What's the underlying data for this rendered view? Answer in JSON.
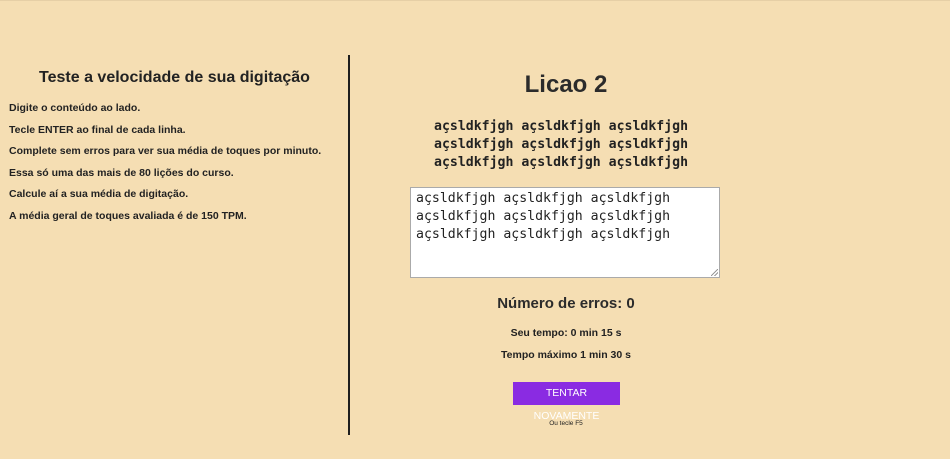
{
  "left_panel": {
    "title": "Teste a velocidade de sua digitação",
    "instructions": [
      "Digite o conteúdo ao lado.",
      "Tecle ENTER ao final de cada linha.",
      "Complete sem erros para ver sua média de toques por minuto.",
      "Essa só uma das mais de 80 lições do curso.",
      "Calcule aí a sua média de digitação.",
      "A média geral de toques avaliada é de 150 TPM."
    ]
  },
  "lesson": {
    "title": "Licao 2",
    "sample_lines": [
      "açsldkfjgh açsldkfjgh açsldkfjgh",
      "açsldkfjgh açsldkfjgh açsldkfjgh",
      "açsldkfjgh açsldkfjgh açsldkfjgh"
    ],
    "typed_text": "açsldkfjgh açsldkfjgh açsldkfjgh\naçsldkfjgh açsldkfjgh açsldkfjgh\naçsldkfjgh açsldkfjgh açsldkfjgh"
  },
  "results": {
    "errors_label": "Número de erros: 0",
    "time_label": "Seu tempo: 0 min 15 s",
    "max_time_label": "Tempo máximo 1 min 30 s"
  },
  "actions": {
    "retry_label": "TENTAR NOVAMENTE",
    "hint": "Ou tecle F5"
  },
  "colors": {
    "background": "#f5deb3",
    "button": "#8a2be2",
    "divider": "#1e1e1e"
  }
}
